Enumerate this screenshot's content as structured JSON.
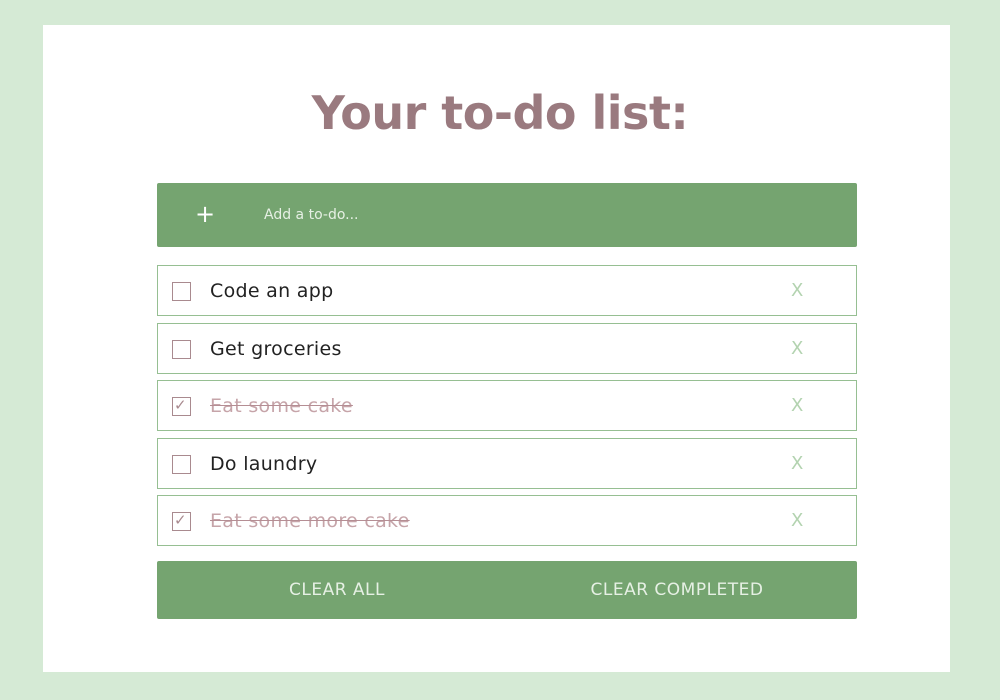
{
  "title": "Your to-do list:",
  "add_bar": {
    "plus_icon": "plus-icon",
    "placeholder": "Add a to-do..."
  },
  "todos": [
    {
      "text": "Code an app",
      "completed": false,
      "delete_label": "X"
    },
    {
      "text": "Get groceries",
      "completed": false,
      "delete_label": "X"
    },
    {
      "text": "Eat some cake",
      "completed": true,
      "delete_label": "X"
    },
    {
      "text": "Do laundry",
      "completed": false,
      "delete_label": "X"
    },
    {
      "text": "Eat some more cake",
      "completed": true,
      "delete_label": "X"
    }
  ],
  "footer": {
    "clear_all_label": "CLEAR ALL",
    "clear_completed_label": "CLEAR COMPLETED"
  },
  "colors": {
    "background": "#d5ead5",
    "accent_green": "#75a470",
    "title": "#9a7a7f",
    "completed_text": "#c6a4a9"
  }
}
